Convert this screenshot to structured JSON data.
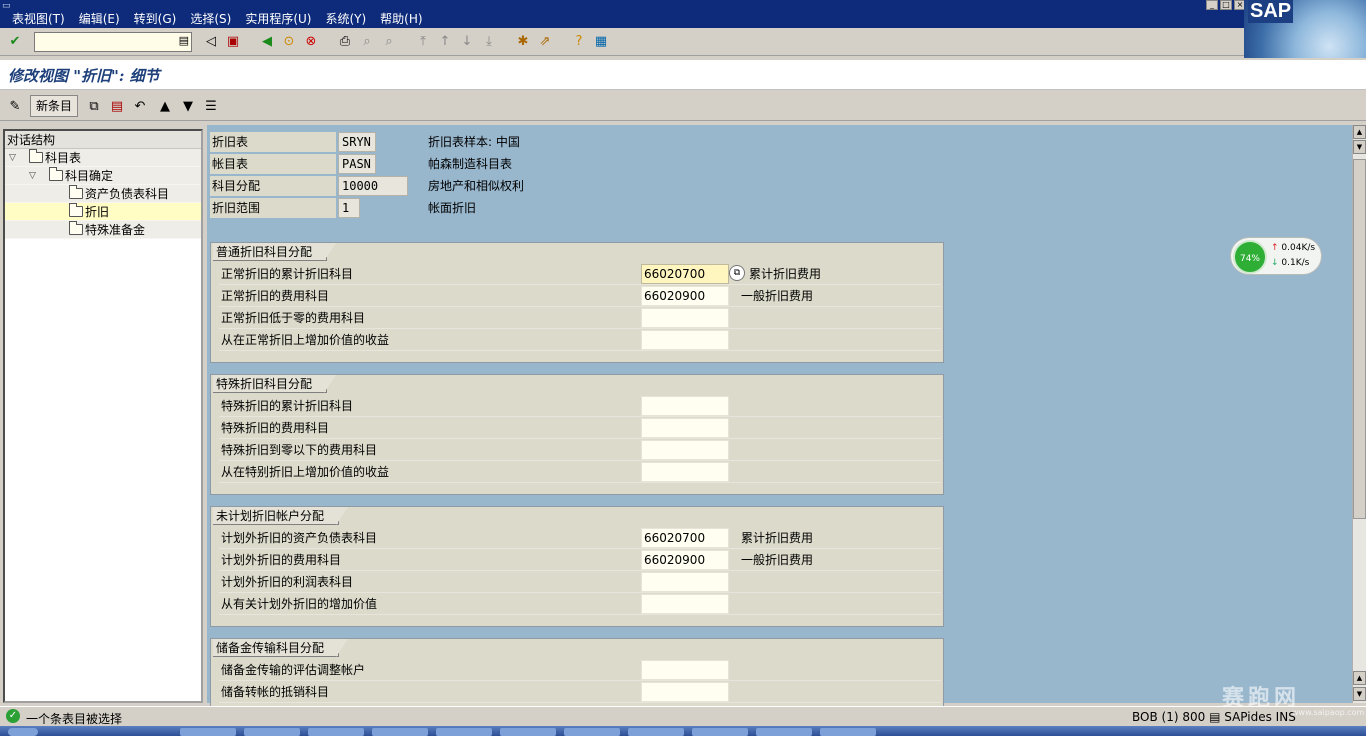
{
  "menu": [
    "表视图(T)",
    "编辑(E)",
    "转到(G)",
    "选择(S)",
    "实用程序(U)",
    "系统(Y)",
    "帮助(H)"
  ],
  "logo_text": "SAP",
  "title": "修改视图 \"折旧\": 细节",
  "toolbar2": {
    "new_entries": "新条目"
  },
  "tree": {
    "header": "对话结构",
    "items": [
      {
        "label": "科目表",
        "level": 0,
        "expanded": true
      },
      {
        "label": "科目确定",
        "level": 1,
        "expanded": true
      },
      {
        "label": "资产负债表科目",
        "level": 2
      },
      {
        "label": "折旧",
        "level": 2,
        "selected": true
      },
      {
        "label": "特殊准备金",
        "level": 2
      }
    ]
  },
  "header_fields": [
    {
      "label": "折旧表",
      "value": "SRYN",
      "desc": "折旧表样本: 中国"
    },
    {
      "label": "帐目表",
      "value": "PASN",
      "desc": "帕森制造科目表"
    },
    {
      "label": "科目分配",
      "value": "10000",
      "desc": "房地产和相似权利"
    },
    {
      "label": "折旧范围",
      "value": "1",
      "desc": "帐面折旧"
    }
  ],
  "groups": [
    {
      "title": "普通折旧科目分配",
      "rows": [
        {
          "label": "正常折旧的累计折旧科目",
          "value": "66020700",
          "desc": "累计折旧费用",
          "focused": true
        },
        {
          "label": "正常折旧的费用科目",
          "value": "66020900",
          "desc": "一般折旧费用"
        },
        {
          "label": "正常折旧低于零的费用科目",
          "value": "",
          "desc": ""
        },
        {
          "label": "从在正常折旧上增加价值的收益",
          "value": "",
          "desc": ""
        }
      ]
    },
    {
      "title": "特殊折旧科目分配",
      "rows": [
        {
          "label": "特殊折旧的累计折旧科目",
          "value": "",
          "desc": ""
        },
        {
          "label": "特殊折旧的费用科目",
          "value": "",
          "desc": ""
        },
        {
          "label": "特殊折旧到零以下的费用科目",
          "value": "",
          "desc": ""
        },
        {
          "label": "从在特别折旧上增加价值的收益",
          "value": "",
          "desc": ""
        }
      ]
    },
    {
      "title": "未计划折旧帐户分配",
      "rows": [
        {
          "label": "计划外折旧的资产负债表科目",
          "value": "66020700",
          "desc": "累计折旧费用"
        },
        {
          "label": "计划外折旧的费用科目",
          "value": "66020900",
          "desc": "一般折旧费用"
        },
        {
          "label": "计划外折旧的利润表科目",
          "value": "",
          "desc": ""
        },
        {
          "label": "从有关计划外折旧的增加价值",
          "value": "",
          "desc": ""
        }
      ]
    },
    {
      "title": "储备金传输科目分配",
      "rows": [
        {
          "label": "储备金传输的评估调整帐户",
          "value": "",
          "desc": ""
        },
        {
          "label": "储备转帐的抵销科目",
          "value": "",
          "desc": ""
        }
      ]
    }
  ],
  "netwidget": {
    "percent": "74%",
    "up": "0.04K/s",
    "down": "0.1K/s"
  },
  "status": {
    "message": "一个条表目被选择",
    "system": "BOB (1) 800",
    "server": "SAPides",
    "mode": "INS"
  },
  "watermark": {
    "text": "赛跑网",
    "url": "www.saipaop.com"
  },
  "colors": {
    "menubar": "#0d2b7a",
    "detail_bg": "#98b6cc",
    "group_bg": "#dcdacb",
    "focus_field": "#fff6bf"
  }
}
